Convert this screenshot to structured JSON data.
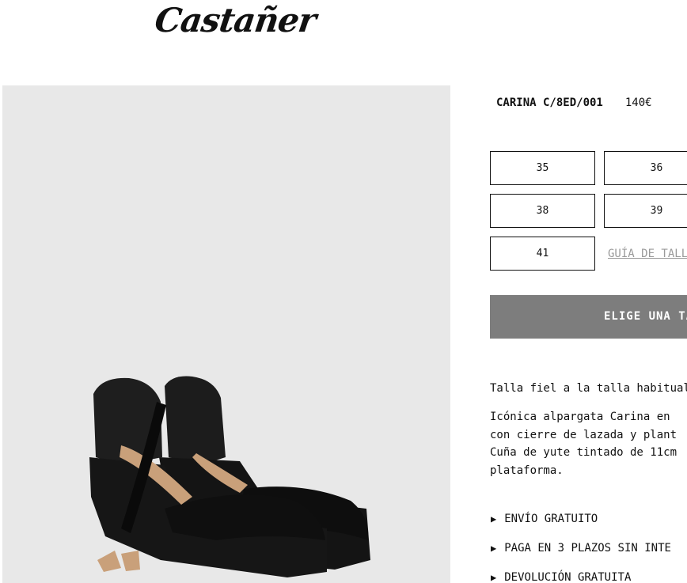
{
  "brand": {
    "logo_text": "Castañer"
  },
  "product": {
    "name": "CARINA C/8ED/001",
    "price": "140€",
    "sizes": [
      "35",
      "36",
      "38",
      "39",
      "41"
    ],
    "size_guide_label": "GUÍA DE TALLAS",
    "cta_label": "ELIGE UNA TALLA",
    "fit_note": "Talla fiel a la talla habitual",
    "description_lines": [
      "Icónica alpargata Carina en",
      "con cierre de lazada y plant",
      "Cuña de yute tintado de 11cm",
      "plataforma."
    ]
  },
  "accordion": [
    {
      "label": "ENVÍO GRATUITO",
      "icon": "triangle-right-icon"
    },
    {
      "label": "PAGA EN 3 PLAZOS SIN INTE",
      "icon": "triangle-right-icon"
    },
    {
      "label": "DEVOLUCIÓN GRATUITA",
      "icon": "triangle-right-icon"
    }
  ],
  "colors": {
    "image_bg": "#e8e8e8",
    "cta_bg": "#7d7d7d",
    "guide_text": "#9a9a9a"
  }
}
